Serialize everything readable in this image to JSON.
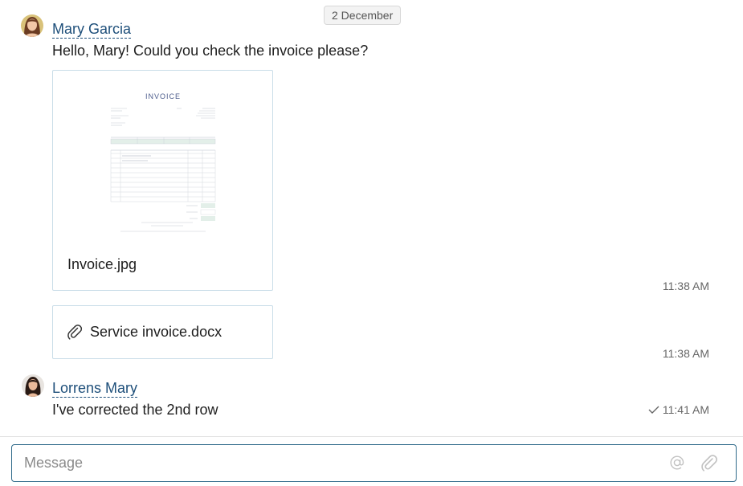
{
  "date_separator": "2 December",
  "messages": [
    {
      "author": "Mary Garcia",
      "text": "Hello, Mary! Could you check the invoice please?",
      "attachments": [
        {
          "type": "image",
          "file_name": "Invoice.jpg",
          "preview_title": "INVOICE",
          "time": "11:38 AM"
        },
        {
          "type": "file",
          "icon": "paperclip-icon",
          "file_name": "Service invoice.docx",
          "time": "11:38 AM"
        }
      ]
    },
    {
      "author": "Lorrens Mary",
      "text": "I've corrected the 2nd row",
      "time": "11:41 AM",
      "status_icon": "checkmark-icon"
    }
  ],
  "composer": {
    "placeholder": "Message",
    "mention_icon": "at-icon",
    "attach_icon": "paperclip-icon"
  },
  "colors": {
    "accent": "#1e4f7a",
    "card_border": "#c9dde8",
    "composer_border": "#2f6a8a"
  }
}
